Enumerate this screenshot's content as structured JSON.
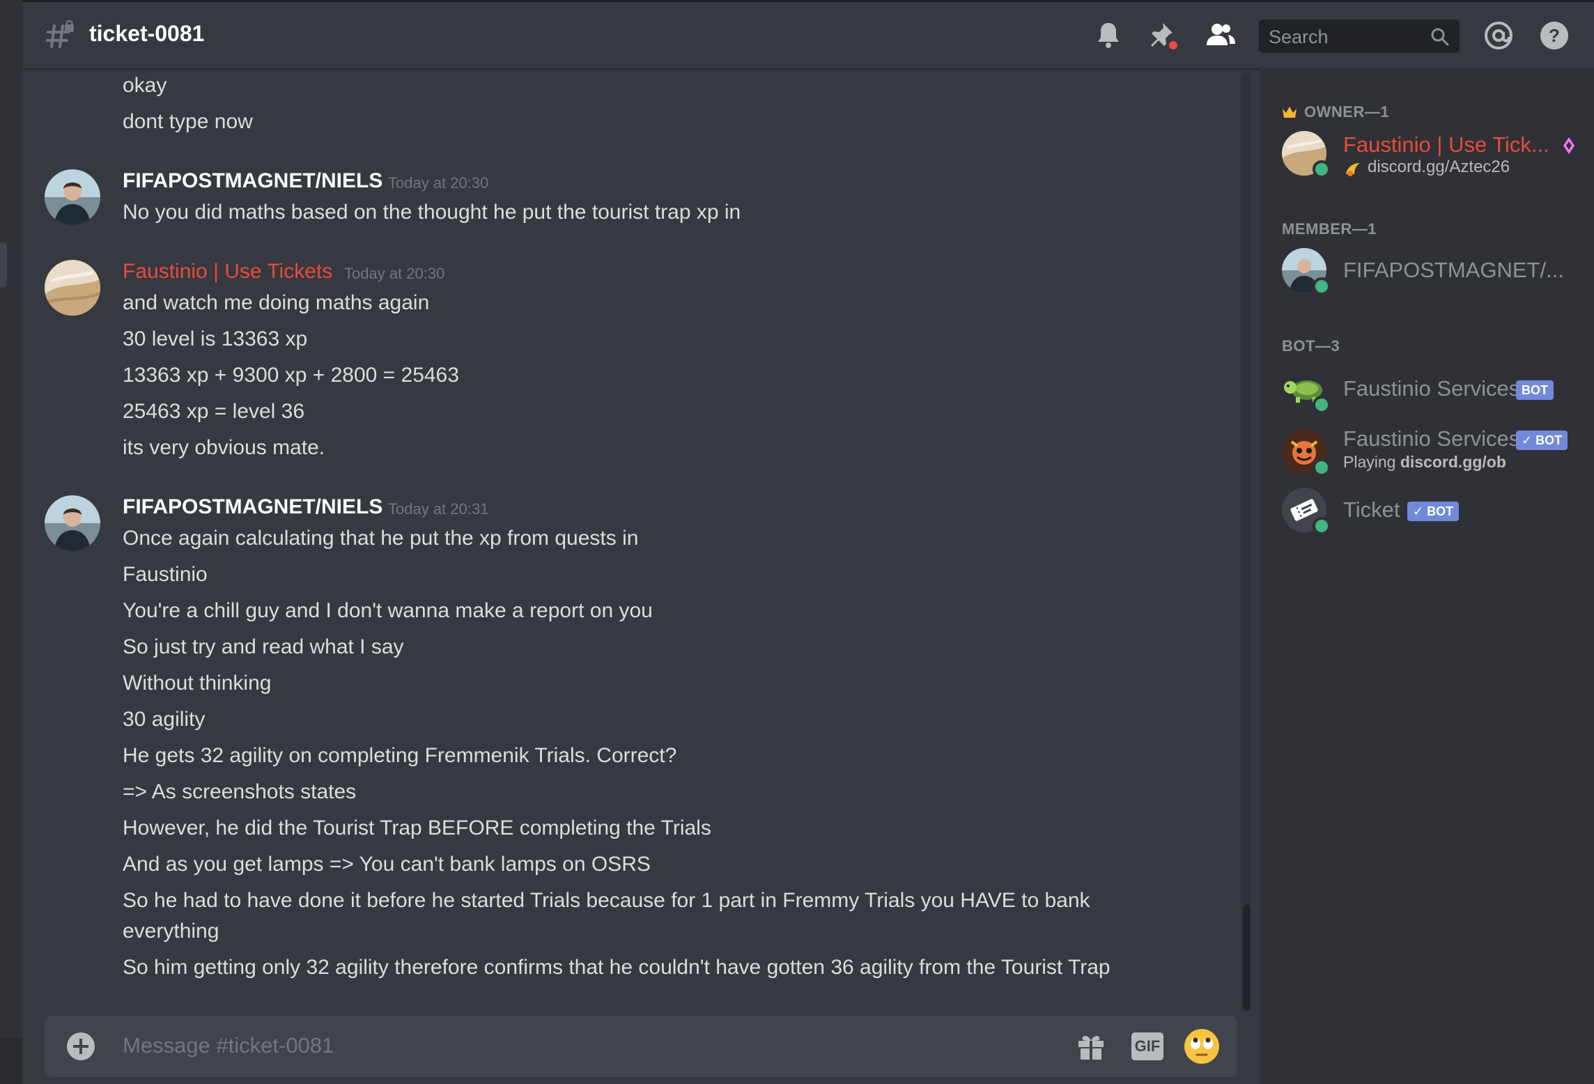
{
  "header": {
    "channel_name": "ticket-0081",
    "search_placeholder": "Search"
  },
  "messages": {
    "continued": [
      "okay",
      "dont type now"
    ],
    "group1": {
      "username": "FIFAPOSTMAGNET/NIELS",
      "timestamp": "Today at 20:30",
      "lines": [
        "No you did maths based on the thought he put the tourist trap xp in"
      ]
    },
    "group2": {
      "username": "Faustinio | Use Tickets",
      "timestamp": "Today at 20:30",
      "lines": [
        "and watch me doing maths again",
        "30 level is 13363 xp",
        "13363 xp +  9300 xp + 2800 = 25463",
        "25463 xp = level 36",
        "its very obvious mate."
      ]
    },
    "group3": {
      "username": "FIFAPOSTMAGNET/NIELS",
      "timestamp": "Today at 20:31",
      "lines": [
        "Once again calculating that he put the xp from quests in",
        "Faustinio",
        "You're a chill guy and I don't wanna make a report on you",
        "So just try and read what I say",
        "Without thinking",
        "30 agility",
        "He gets 32 agility on completing Fremmenik Trials. Correct?",
        "=> As screenshots states",
        "However, he did the Tourist Trap BEFORE completing the Trials",
        "And as you get lamps => You can't bank lamps on OSRS",
        "So he had to have done it before he started Trials because for 1 part in Fremmy Trials you HAVE to bank",
        "everything",
        "So him getting only 32 agility therefore confirms that he couldn't have gotten 36 agility from the Tourist Trap"
      ]
    }
  },
  "composer": {
    "placeholder": "Message #ticket-0081",
    "gif_label": "GIF"
  },
  "members": {
    "owner_title": "OWNER—1",
    "owner": {
      "name": "Faustinio | Use Tick...",
      "status": "discord.gg/Aztec26"
    },
    "member_title": "MEMBER—1",
    "member": {
      "name": "FIFAPOSTMAGNET/..."
    },
    "bot_title": "BOT—3",
    "bots": [
      {
        "name": "Faustinio Services",
        "tag": "BOT"
      },
      {
        "name": "Faustinio Services",
        "tag": "BOT",
        "activity_prefix": "Playing",
        "activity": "discord.gg/ob"
      },
      {
        "name": "Ticket",
        "tag": "BOT"
      }
    ]
  },
  "colors": {
    "background": "#36393f",
    "sidebar": "#2f3136",
    "owner_name": "#e74c3c",
    "online": "#43b581",
    "bot_tag": "#7289da"
  }
}
